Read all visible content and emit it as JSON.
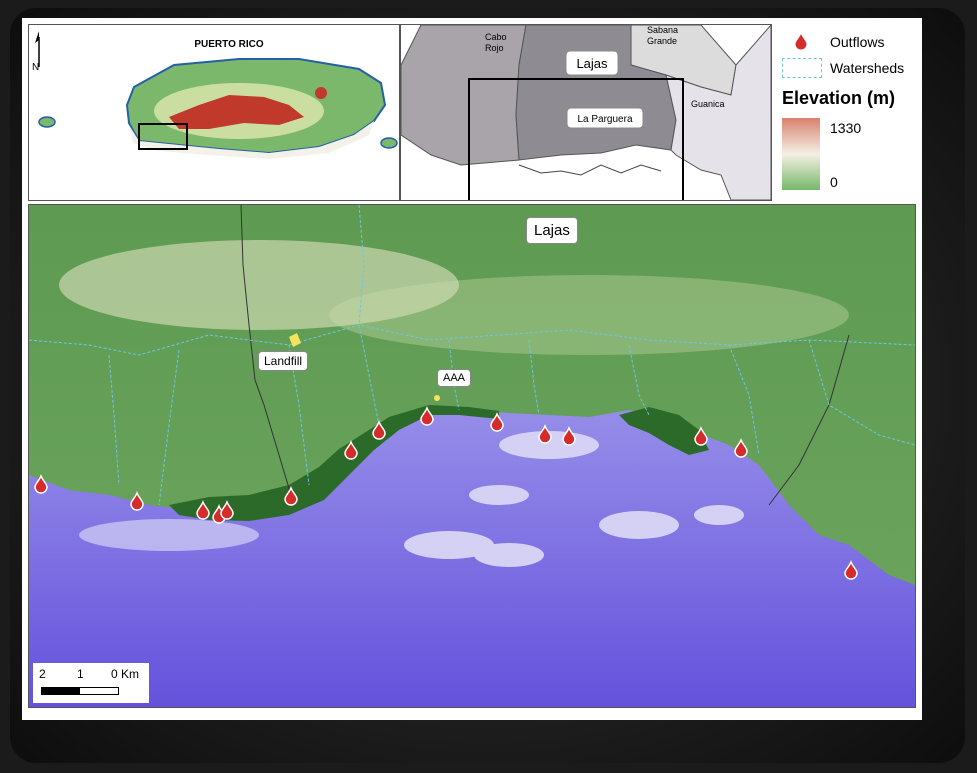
{
  "inset_pr": {
    "title": "PUERTO RICO",
    "north_label": "N"
  },
  "inset_local": {
    "places": {
      "cabo_rojo_1": "Cabo",
      "cabo_rojo_2": "Rojo",
      "sabana_1": "Sabana",
      "sabana_2": "Grande",
      "lajas": "Lajas",
      "la_parguera": "La Parguera",
      "guanica": "Guanica"
    }
  },
  "legend": {
    "outflows": "Outflows",
    "watersheds": "Watersheds",
    "elevation_title": "Elevation (m)",
    "elev_max": "1330",
    "elev_min": "0",
    "colors": {
      "high": "#d9816f",
      "mid": "#f4f0e4",
      "low": "#77b86a",
      "outflow": "#d42b2b",
      "watershed": "#6cc6e6"
    }
  },
  "main_map": {
    "labels": {
      "lajas": "Lajas",
      "landfill": "Landfill",
      "aaa": "AAA"
    },
    "scale": {
      "t2": "2",
      "t1": "1",
      "t0": "0 Km"
    },
    "outflow_icon": "water-drop-icon",
    "outflow_count": 16
  }
}
